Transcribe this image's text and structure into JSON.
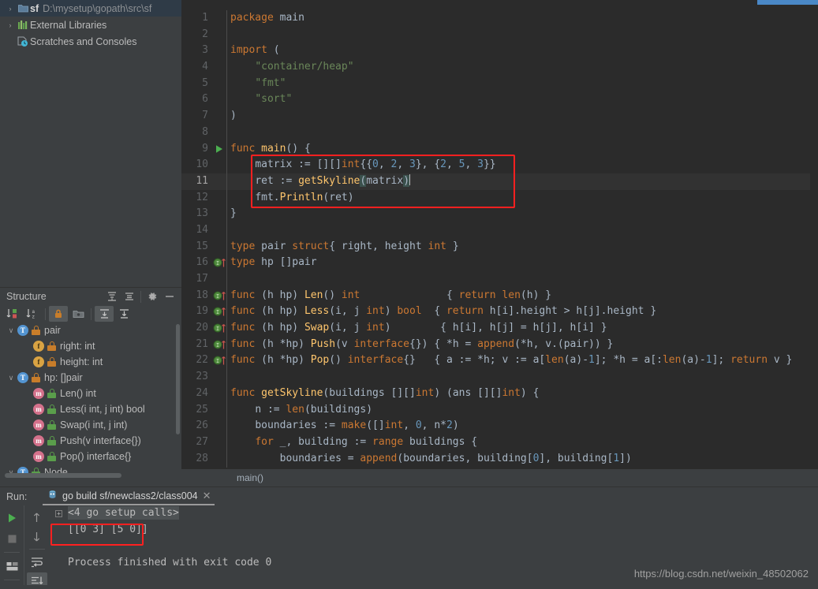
{
  "project": {
    "items": [
      {
        "arrow": "›",
        "icon": "folder-icon",
        "name": "sf",
        "path": "D:\\mysetup\\gopath\\src\\sf",
        "selected": true
      },
      {
        "arrow": "›",
        "icon": "library-icon",
        "name": "External Libraries",
        "path": "",
        "selected": false
      },
      {
        "arrow": "",
        "icon": "scratches-icon",
        "name": "Scratches and Consoles",
        "path": "",
        "selected": false
      }
    ]
  },
  "structure": {
    "title": "Structure",
    "header_buttons": [
      "expand-all-icon",
      "collapse-all-icon",
      "settings-gear-icon",
      "hide-icon"
    ],
    "toolbar_buttons": [
      "sort-by-visibility-icon",
      "sort-alphabetically-icon",
      "show-non-public-icon",
      "group-icon",
      "scroll-from-source-icon",
      "scroll-to-source-icon"
    ],
    "items": [
      {
        "indent": 0,
        "arrow": "∨",
        "badge": "T",
        "badge_kind": "t",
        "lock": "orange",
        "label": "pair"
      },
      {
        "indent": 1,
        "arrow": "",
        "badge": "f",
        "badge_kind": "f",
        "lock": "orange",
        "label": "right: int"
      },
      {
        "indent": 1,
        "arrow": "",
        "badge": "f",
        "badge_kind": "f",
        "lock": "orange",
        "label": "height: int"
      },
      {
        "indent": 0,
        "arrow": "∨",
        "badge": "T",
        "badge_kind": "t",
        "lock": "orange",
        "label": "hp: []pair"
      },
      {
        "indent": 1,
        "arrow": "",
        "badge": "m",
        "badge_kind": "m",
        "lock": "green",
        "label": "Len() int"
      },
      {
        "indent": 1,
        "arrow": "",
        "badge": "m",
        "badge_kind": "m",
        "lock": "green",
        "label": "Less(i int, j int) bool"
      },
      {
        "indent": 1,
        "arrow": "",
        "badge": "m",
        "badge_kind": "m",
        "lock": "green",
        "label": "Swap(i int, j int)"
      },
      {
        "indent": 1,
        "arrow": "",
        "badge": "m",
        "badge_kind": "m",
        "lock": "green",
        "label": "Push(v interface{})"
      },
      {
        "indent": 1,
        "arrow": "",
        "badge": "m",
        "badge_kind": "m",
        "lock": "green",
        "label": "Pop() interface{}"
      },
      {
        "indent": 0,
        "arrow": "∨",
        "badge": "T",
        "badge_kind": "t",
        "lock": "green",
        "label": "Node"
      }
    ]
  },
  "editor": {
    "breadcrumb": "main()",
    "current_line": 11,
    "first_line": 1,
    "lines": [
      {
        "n": 1,
        "gutter": ""
      },
      {
        "n": 2,
        "gutter": ""
      },
      {
        "n": 3,
        "gutter": ""
      },
      {
        "n": 4,
        "gutter": ""
      },
      {
        "n": 5,
        "gutter": ""
      },
      {
        "n": 6,
        "gutter": ""
      },
      {
        "n": 7,
        "gutter": ""
      },
      {
        "n": 8,
        "gutter": ""
      },
      {
        "n": 9,
        "gutter": "run-arrow-icon"
      },
      {
        "n": 10,
        "gutter": ""
      },
      {
        "n": 11,
        "gutter": ""
      },
      {
        "n": 12,
        "gutter": ""
      },
      {
        "n": 13,
        "gutter": ""
      },
      {
        "n": 14,
        "gutter": ""
      },
      {
        "n": 15,
        "gutter": ""
      },
      {
        "n": 16,
        "gutter": "implements-icon"
      },
      {
        "n": 17,
        "gutter": ""
      },
      {
        "n": 18,
        "gutter": "implements-icon"
      },
      {
        "n": 19,
        "gutter": "implements-icon"
      },
      {
        "n": 20,
        "gutter": "implements-icon"
      },
      {
        "n": 21,
        "gutter": "implements-icon"
      },
      {
        "n": 22,
        "gutter": "implements-icon"
      },
      {
        "n": 23,
        "gutter": ""
      },
      {
        "n": 24,
        "gutter": ""
      },
      {
        "n": 25,
        "gutter": ""
      },
      {
        "n": 26,
        "gutter": ""
      },
      {
        "n": 27,
        "gutter": ""
      },
      {
        "n": 28,
        "gutter": ""
      }
    ],
    "code": [
      "package main",
      "",
      "import (",
      "    \"container/heap\"",
      "    \"fmt\"",
      "    \"sort\"",
      ")",
      "",
      "func main() {",
      "    matrix := [][]int{{0, 2, 3}, {2, 5, 3}}",
      "    ret := getSkyline(matrix)",
      "    fmt.Println(ret)",
      "}",
      "",
      "type pair struct{ right, height int }",
      "type hp []pair",
      "",
      "func (h hp) Len() int              { return len(h) }",
      "func (h hp) Less(i, j int) bool  { return h[i].height > h[j].height }",
      "func (h hp) Swap(i, j int)        { h[i], h[j] = h[j], h[i] }",
      "func (h *hp) Push(v interface{}) { *h = append(*h, v.(pair)) }",
      "func (h *hp) Pop() interface{}   { a := *h; v := a[len(a)-1]; *h = a[:len(a)-1]; return v }",
      "",
      "func getSkyline(buildings [][]int) (ans [][]int) {",
      "    n := len(buildings)",
      "    boundaries := make([]int, 0, n*2)",
      "    for _, building := range buildings {",
      "        boundaries = append(boundaries, building[0], building[1])"
    ]
  },
  "run": {
    "label": "Run:",
    "tab_title": "go build sf/newclass2/class004",
    "tab_icon": "go-run-config-icon",
    "close_icon": "close-icon",
    "side_buttons": [
      "rerun-icon",
      "stop-icon",
      "layout-icon"
    ],
    "side_buttons2": [
      "up-arrow-icon",
      "down-arrow-icon",
      "soft-wrap-icon",
      "scroll-to-end-icon"
    ],
    "console": [
      {
        "text": "<4 go setup calls>",
        "style": "setup",
        "collapsible": true
      },
      {
        "text": "[[0 3] [5 0]]",
        "style": "output",
        "collapsible": false
      },
      {
        "text": "",
        "style": "blank",
        "collapsible": false
      },
      {
        "text": "Process finished with exit code 0",
        "style": "normal",
        "collapsible": false
      }
    ]
  },
  "watermark": "https://blog.csdn.net/weixin_48502062",
  "colors": {
    "editor_bg": "#2b2b2b",
    "panel_bg": "#3c3f41",
    "accent_blue": "#4a88c7",
    "highlight_red": "#ff2020",
    "keyword": "#cc7832",
    "string": "#6a8759",
    "number": "#6897bb",
    "function": "#ffc66d",
    "selection_blue": "#2f3b47"
  }
}
